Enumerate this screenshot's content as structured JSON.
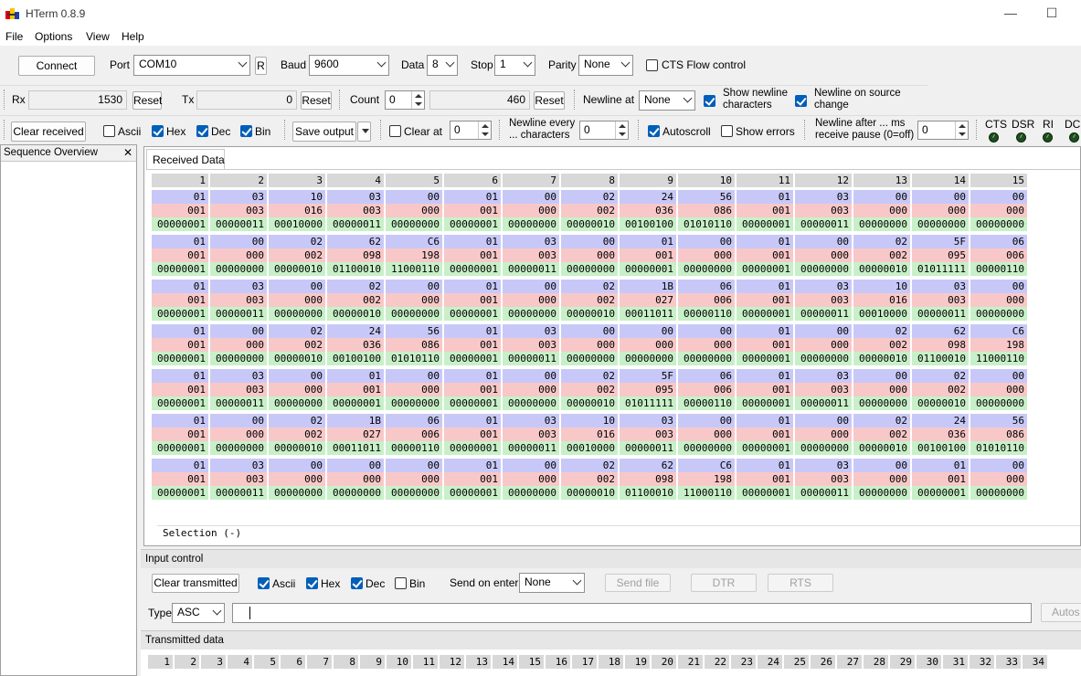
{
  "window": {
    "title": "HTerm 0.8.9",
    "minimize": "—",
    "maximize": "☐"
  },
  "menu": [
    "File",
    "Options",
    "View",
    "Help"
  ],
  "connection": {
    "connect_label": "Connect",
    "port_label": "Port",
    "port_value": "COM10",
    "r_label": "R",
    "baud_label": "Baud",
    "baud_value": "9600",
    "data_label": "Data",
    "data_value": "8",
    "stop_label": "Stop",
    "stop_value": "1",
    "parity_label": "Parity",
    "parity_value": "None",
    "cts_label": "CTS Flow control"
  },
  "counters": {
    "rx_label": "Rx",
    "rx_value": "1530",
    "reset_label": "Reset",
    "tx_label": "Tx",
    "tx_value": "0",
    "count_label": "Count",
    "count_value": "0",
    "count_total": "460",
    "newline_at_label": "Newline at",
    "newline_at_value": "None",
    "show_newline": "Show newline characters",
    "newline_on": "Newline on source change"
  },
  "receive_toolbar": {
    "clear_received": "Clear received",
    "ascii": "Ascii",
    "hex": "Hex",
    "dec": "Dec",
    "bin": "Bin",
    "save_output": "Save output",
    "clear_at": "Clear at",
    "clear_at_value": "0",
    "newline_every": "Newline every ... characters",
    "newline_every_value": "0",
    "autoscroll": "Autoscroll",
    "show_errors": "Show errors",
    "newline_after": "Newline after ... ms receive pause (0=off)",
    "newline_after_value": "0",
    "cts": "CTS",
    "dsr": "DSR",
    "ri": "RI",
    "dcd": "DCD"
  },
  "sequence": {
    "title": "Sequence Overview",
    "close": "✕"
  },
  "received": {
    "tab": "Received Data",
    "selection": "Selection (-)",
    "headers": [
      "1",
      "2",
      "3",
      "4",
      "5",
      "6",
      "7",
      "8",
      "9",
      "10",
      "11",
      "12",
      "13",
      "14",
      "15"
    ],
    "rows": [
      [
        "01",
        "03",
        "10",
        "03",
        "00",
        "01",
        "00",
        "02",
        "24",
        "56",
        "01",
        "03",
        "00",
        "00",
        "00"
      ],
      [
        "01",
        "00",
        "02",
        "62",
        "C6",
        "01",
        "03",
        "00",
        "01",
        "00",
        "01",
        "00",
        "02",
        "5F",
        "06"
      ],
      [
        "01",
        "03",
        "00",
        "02",
        "00",
        "01",
        "00",
        "02",
        "1B",
        "06",
        "01",
        "03",
        "10",
        "03",
        "00"
      ],
      [
        "01",
        "00",
        "02",
        "24",
        "56",
        "01",
        "03",
        "00",
        "00",
        "00",
        "01",
        "00",
        "02",
        "62",
        "C6"
      ],
      [
        "01",
        "03",
        "00",
        "01",
        "00",
        "01",
        "00",
        "02",
        "5F",
        "06",
        "01",
        "03",
        "00",
        "02",
        "00"
      ],
      [
        "01",
        "00",
        "02",
        "1B",
        "06",
        "01",
        "03",
        "10",
        "03",
        "00",
        "01",
        "00",
        "02",
        "24",
        "56"
      ],
      [
        "01",
        "03",
        "00",
        "00",
        "00",
        "01",
        "00",
        "02",
        "62",
        "C6",
        "01",
        "03",
        "00",
        "01",
        "00"
      ]
    ]
  },
  "input_control": {
    "title": "Input control",
    "clear_transmitted": "Clear transmitted",
    "ascii": "Ascii",
    "hex": "Hex",
    "dec": "Dec",
    "bin": "Bin",
    "send_on_enter": "Send on enter",
    "send_on_enter_value": "None",
    "send_file": "Send file",
    "dtr": "DTR",
    "rts": "RTS",
    "type_label": "Type",
    "type_value": "ASC",
    "autosend": "Autos"
  },
  "transmitted": {
    "title": "Transmitted data",
    "headers": [
      "1",
      "2",
      "3",
      "4",
      "5",
      "6",
      "7",
      "8",
      "9",
      "10",
      "11",
      "12",
      "13",
      "14",
      "15",
      "16",
      "17",
      "18",
      "19",
      "20",
      "21",
      "22",
      "23",
      "24",
      "25",
      "26",
      "27",
      "28",
      "29",
      "30",
      "31",
      "32",
      "33",
      "34"
    ]
  }
}
